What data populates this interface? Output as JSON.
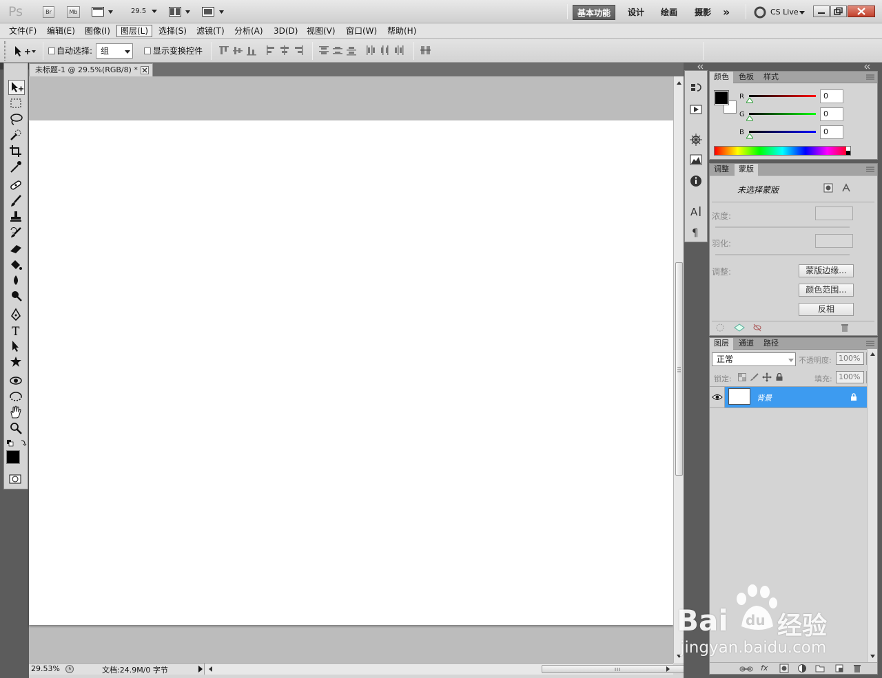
{
  "app": {
    "logo": "Ps",
    "bridge_label": "Br",
    "minibridge_label": "Mb",
    "zoom_value": "29.5"
  },
  "workspaces": [
    "基本功能",
    "设计",
    "绘画",
    "摄影",
    "»"
  ],
  "cs_live": "CS Live",
  "menus": [
    "文件(F)",
    "编辑(E)",
    "图像(I)",
    "图层(L)",
    "选择(S)",
    "滤镜(T)",
    "分析(A)",
    "3D(D)",
    "视图(V)",
    "窗口(W)",
    "帮助(H)"
  ],
  "active_menu": "图层(L)",
  "options": {
    "auto_select_label": "自动选择:",
    "auto_select_value": "组",
    "show_transform_label": "显示变换控件"
  },
  "document": {
    "tab_title": "未标题-1 @ 29.5%(RGB/8) *",
    "zoom_status": "29.53%",
    "doc_info": "文档:24.9M/0 字节"
  },
  "color_panel": {
    "tabs": [
      "颜色",
      "色板",
      "样式"
    ],
    "channels": [
      {
        "label": "R",
        "value": "0"
      },
      {
        "label": "G",
        "value": "0"
      },
      {
        "label": "B",
        "value": "0"
      }
    ],
    "foreground": "#000000",
    "background": "#ffffff"
  },
  "masks_panel": {
    "tabs": [
      "调整",
      "蒙版"
    ],
    "no_mask_selected": "未选择蒙版",
    "density_label": "浓度:",
    "feather_label": "羽化:",
    "refine_label": "调整:",
    "mask_edge_button": "蒙版边缘...",
    "color_range_button": "颜色范围...",
    "invert_button": "反相"
  },
  "layers_panel": {
    "tabs": [
      "图层",
      "通道",
      "路径"
    ],
    "blend_mode": "正常",
    "opacity_label": "不透明度:",
    "opacity_value": "100%",
    "lock_label": "锁定:",
    "fill_label": "填充:",
    "fill_value": "100%",
    "layers": [
      {
        "name": "背景",
        "selected": true,
        "locked": true
      }
    ],
    "footer_fx": "fx"
  },
  "watermark": {
    "brand": "Bai",
    "brand_tail": "经验",
    "url": "jingyan.baidu.com"
  },
  "colors": {
    "accent_selection": "#3d9bf0",
    "close_red": "#c2412c"
  }
}
